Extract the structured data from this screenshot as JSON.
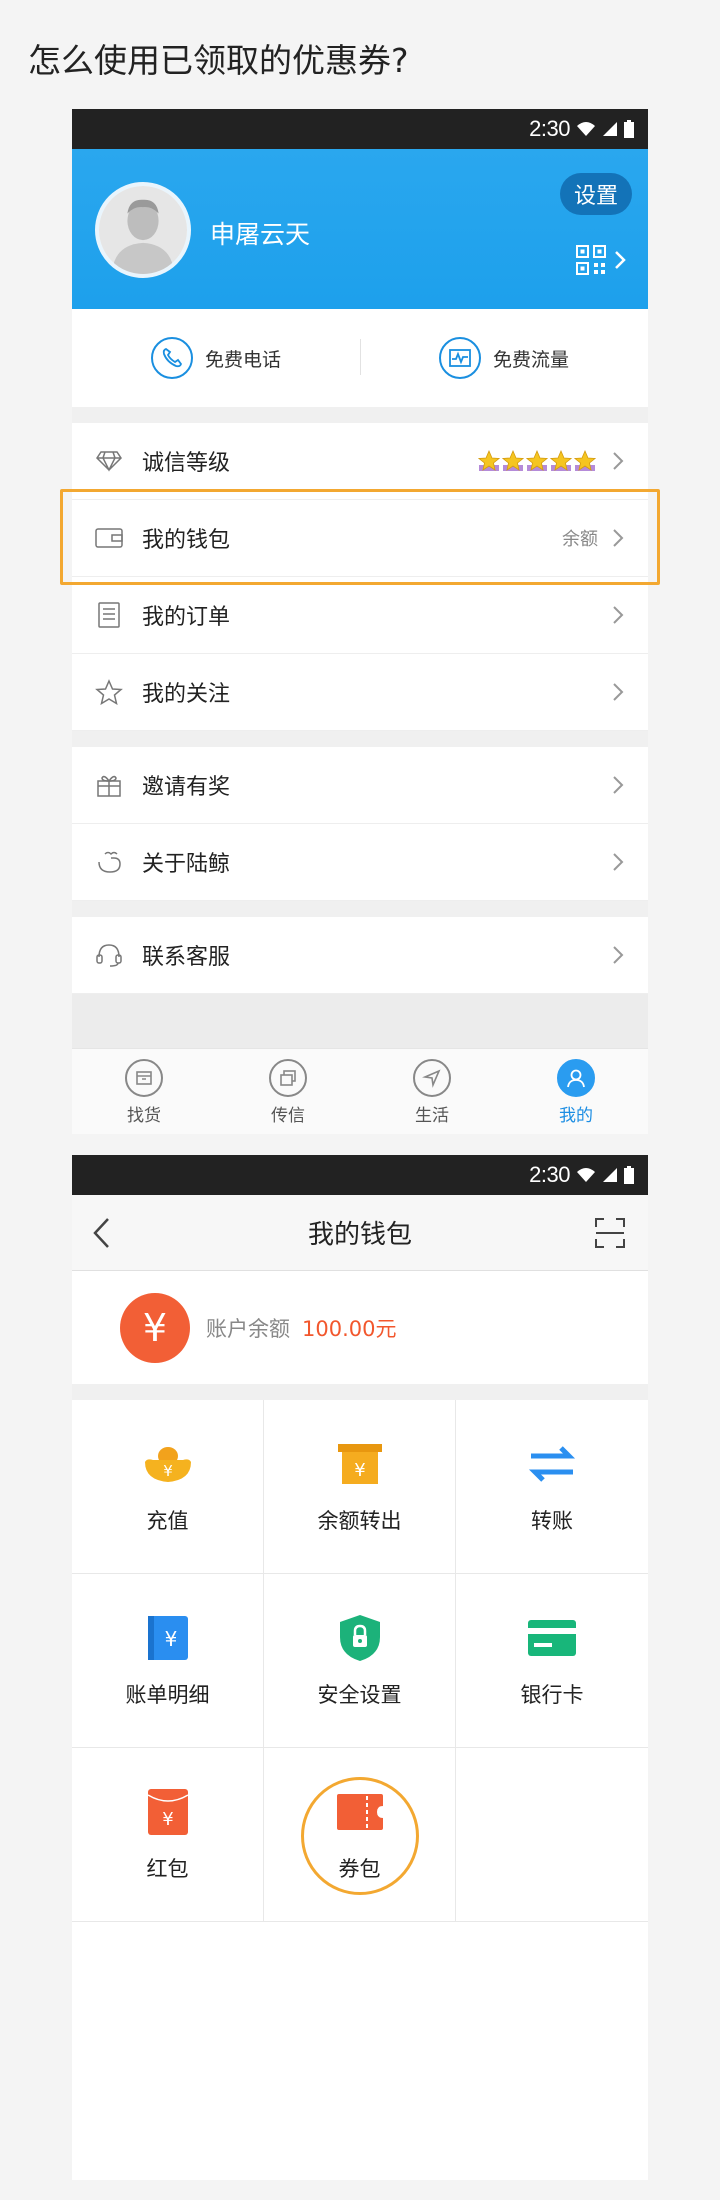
{
  "question": "怎么使用已领取的优惠券?",
  "status": {
    "time": "2:30"
  },
  "profile": {
    "username": "申屠云天",
    "settings_label": "设置"
  },
  "quick_actions": [
    {
      "label": "免费电话",
      "icon": "phone-icon"
    },
    {
      "label": "免费流量",
      "icon": "traffic-icon"
    }
  ],
  "menu": {
    "credit": {
      "label": "诚信等级",
      "stars": 5
    },
    "wallet": {
      "label": "我的钱包",
      "value": "余额"
    },
    "orders": {
      "label": "我的订单"
    },
    "follows": {
      "label": "我的关注"
    },
    "invite": {
      "label": "邀请有奖"
    },
    "about": {
      "label": "关于陆鲸"
    },
    "service": {
      "label": "联系客服"
    }
  },
  "tabs": [
    {
      "label": "找货",
      "icon": "cargo-icon",
      "active": false
    },
    {
      "label": "传信",
      "icon": "message-icon",
      "active": false
    },
    {
      "label": "生活",
      "icon": "navigate-icon",
      "active": false
    },
    {
      "label": "我的",
      "icon": "user-icon",
      "active": true
    }
  ],
  "wallet_page": {
    "title": "我的钱包",
    "balance_label": "账户余额",
    "balance_value": "100.00元",
    "yuan_symbol": "¥",
    "grid": [
      {
        "label": "充值",
        "icon": "gold-ingot-icon"
      },
      {
        "label": "余额转出",
        "icon": "transfer-out-icon"
      },
      {
        "label": "转账",
        "icon": "transfer-arrows-icon"
      },
      {
        "label": "账单明细",
        "icon": "bill-icon"
      },
      {
        "label": "安全设置",
        "icon": "shield-lock-icon"
      },
      {
        "label": "银行卡",
        "icon": "bank-card-icon"
      },
      {
        "label": "红包",
        "icon": "red-packet-icon"
      },
      {
        "label": "券包",
        "icon": "coupon-icon"
      }
    ]
  },
  "colors": {
    "header_blue": "#1da0ec",
    "highlight_orange": "#f3a831",
    "balance_red": "#f2572d"
  }
}
